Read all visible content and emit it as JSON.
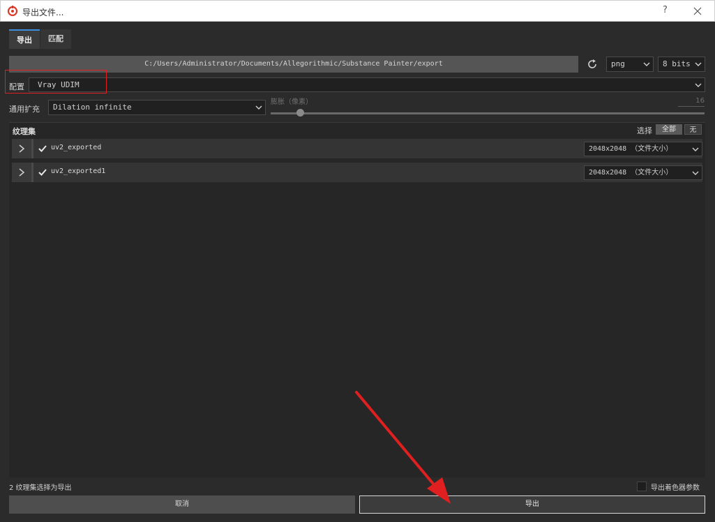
{
  "window": {
    "title": "导出文件...",
    "help": "?"
  },
  "tabs": [
    {
      "label": "导出",
      "active": true
    },
    {
      "label": "匹配",
      "active": false
    }
  ],
  "export": {
    "path": "C:/Users/Administrator/Documents/Allegorithmic/Substance Painter/export",
    "format": "png",
    "bit_depth": "8 bits",
    "config_label": "配置",
    "config_value": "Vray UDIM",
    "padding_label": "通用扩充",
    "padding_value": "Dilation infinite",
    "dilation_label": "膨胀（像素）",
    "dilation_value": "16",
    "dilation_level_fraction": 0.06
  },
  "texture_sets": {
    "title": "纹理集",
    "select_label": "选择",
    "select_all": "全部",
    "select_none": "无",
    "items": [
      {
        "name": "uv2_exported",
        "checked": true,
        "resolution": "2048x2048 （文件大小）"
      },
      {
        "name": "uv2_exported1",
        "checked": true,
        "resolution": "2048x2048 （文件大小）"
      }
    ]
  },
  "footer": {
    "status": "2 纹理集选择为导出",
    "shader_params_label": "导出着色器参数",
    "shader_params_checked": false,
    "cancel": "取消",
    "export": "导出"
  },
  "colors": {
    "background": "#2b2b2b",
    "accent_blue": "#3d8ee0",
    "annotation_red": "#e02020"
  }
}
